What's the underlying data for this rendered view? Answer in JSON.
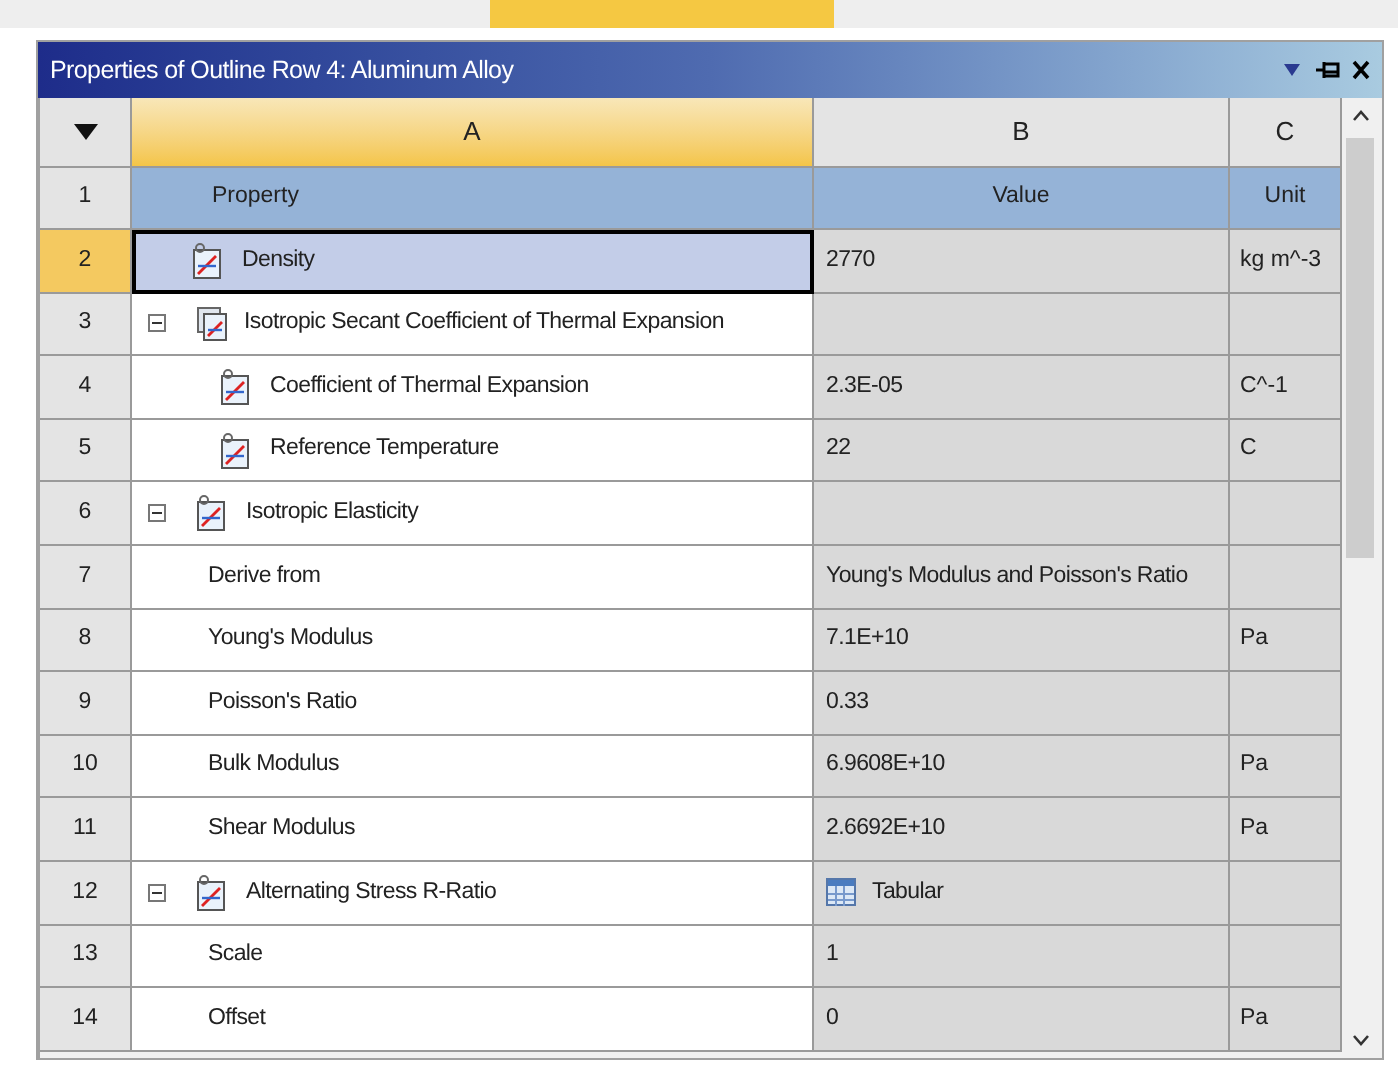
{
  "window": {
    "title": "Properties of Outline Row 4: Aluminum Alloy"
  },
  "table": {
    "columns": [
      {
        "label": "A",
        "selected": true
      },
      {
        "label": "B",
        "selected": false
      },
      {
        "label": "C",
        "selected": false
      }
    ],
    "header": {
      "number": "1",
      "property": "Property",
      "value": "Value",
      "unit": "Unit"
    },
    "rows": [
      {
        "kind": "property",
        "number": "2",
        "property": "Density",
        "value": "2770",
        "unit": "kg m^-3",
        "selected": true
      },
      {
        "kind": "multigroup",
        "number": "3",
        "property": "Isotropic Secant Coefficient of Thermal Expansion",
        "expanded": true,
        "selected": false,
        "children": [
          {
            "kind": "property",
            "number": "4",
            "property": "Coefficient of Thermal Expansion",
            "value": "2.3E-05",
            "unit": "C^-1",
            "selected": false
          },
          {
            "kind": "property",
            "number": "5",
            "property": "Reference Temperature",
            "value": "22",
            "unit": "C",
            "selected": false
          }
        ]
      },
      {
        "kind": "group",
        "number": "6",
        "property": "Isotropic Elasticity",
        "expanded": true,
        "selected": false,
        "children": [
          {
            "kind": "field",
            "number": "7",
            "property": "Derive from",
            "value": "Young's Modulus and Poisson's Ratio",
            "selected": false
          },
          {
            "kind": "field",
            "number": "8",
            "property": "Young's Modulus",
            "value": "7.1E+10",
            "unit": "Pa",
            "selected": false
          },
          {
            "kind": "field",
            "number": "9",
            "property": "Poisson's Ratio",
            "value": "0.33",
            "selected": false
          },
          {
            "kind": "field",
            "number": "10",
            "property": "Bulk Modulus",
            "value": "6.9608E+10",
            "unit": "Pa",
            "selected": false
          },
          {
            "kind": "field",
            "number": "11",
            "property": "Shear Modulus",
            "value": "2.6692E+10",
            "unit": "Pa",
            "selected": false
          }
        ]
      },
      {
        "kind": "tablegroup",
        "number": "12",
        "property": "Alternating Stress R-Ratio",
        "value": "Tabular",
        "expanded": true,
        "selected": false,
        "children": [
          {
            "kind": "field",
            "number": "13",
            "property": "Scale",
            "value": "1",
            "selected": false
          },
          {
            "kind": "field",
            "number": "14",
            "property": "Offset",
            "value": "0",
            "unit": "Pa",
            "selected": false
          }
        ]
      }
    ]
  }
}
